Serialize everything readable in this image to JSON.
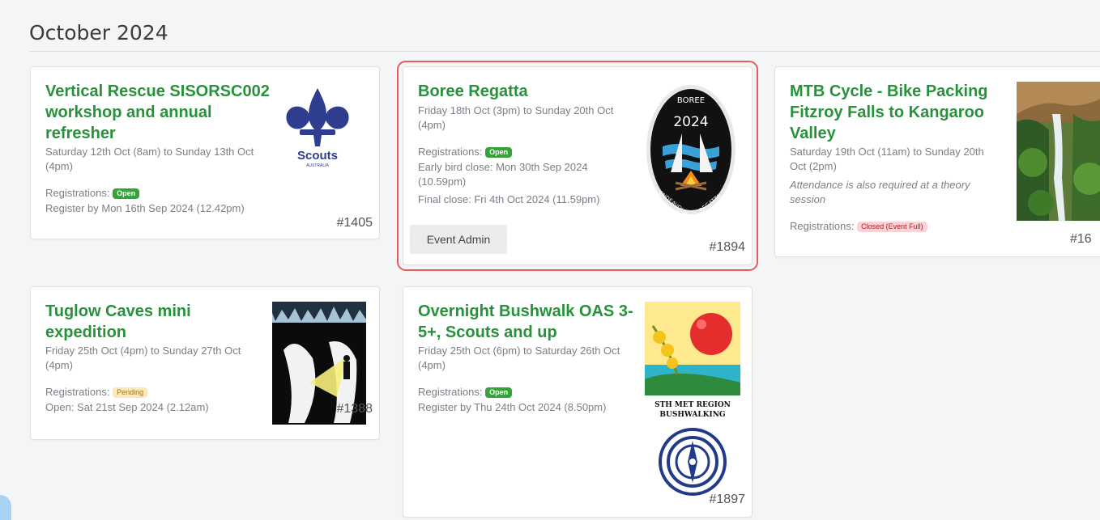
{
  "section": {
    "heading": "October 2024"
  },
  "events": [
    {
      "title": "Vertical Rescue SISORSC002 workshop and annual refresher",
      "dates": "Saturday 12th Oct (8am) to Sunday 13th Oct (4pm)",
      "reg_label": "Registrations:",
      "reg_status": "Open",
      "details": [
        "Register by Mon 16th Sep 2024 (12.42pm)"
      ],
      "id": "#1405",
      "image": "scouts-australia-logo",
      "logo_text": "Scouts",
      "logo_subtext": "AUSTRALIA"
    },
    {
      "title": "Boree Regatta",
      "dates": "Friday 18th Oct (3pm) to Sunday 20th Oct (4pm)",
      "reg_label": "Registrations:",
      "reg_status": "Open",
      "details": [
        "Early bird close: Mon 30th Sep 2024 (10.59pm)",
        "Final close: Fri 4th Oct 2024 (11.59pm)"
      ],
      "admin_label": "Event Admin",
      "id": "#1894",
      "image": "boree-regatta-badge",
      "badge_top": "BOREE",
      "badge_year": "2024",
      "badge_left": "ENDEAVOUR",
      "badge_right": "REGATTA"
    },
    {
      "title": "MTB Cycle - Bike Packing Fitzroy Falls to Kangaroo Valley",
      "dates": "Saturday 19th Oct (11am) to Sunday 20th Oct (2pm)",
      "note": "Attendance is also required at a theory session",
      "reg_label": "Registrations:",
      "reg_status": "Closed (Event Full)",
      "id": "#16",
      "image": "waterfall-photo"
    },
    {
      "title": "Tuglow Caves mini expedition",
      "dates": "Friday 25th Oct (4pm) to Sunday 27th Oct (4pm)",
      "reg_label": "Registrations:",
      "reg_status": "Pending",
      "details": [
        "Open: Sat 21st Sep 2024 (2.12am)"
      ],
      "id": "#1388",
      "image": "cave-silhouette-image"
    },
    {
      "title": "Overnight Bushwalk OAS 3-5+, Scouts and up",
      "dates": "Friday 25th Oct (6pm) to Saturday 26th Oct (4pm)",
      "reg_label": "Registrations:",
      "reg_status": "Open",
      "details": [
        "Register by Thu 24th Oct 2024 (8.50pm)"
      ],
      "id": "#1897",
      "image": "bushwalking-badge",
      "badge_line1": "STH MET REGION",
      "badge_line2": "BUSHWALKING"
    }
  ],
  "colors": {
    "title_green": "#27913b",
    "open_badge": "#36a33a",
    "pending_badge": "#fbe8b5",
    "closed_badge": "#fad3d6",
    "selected_outline": "#e35d5d"
  }
}
